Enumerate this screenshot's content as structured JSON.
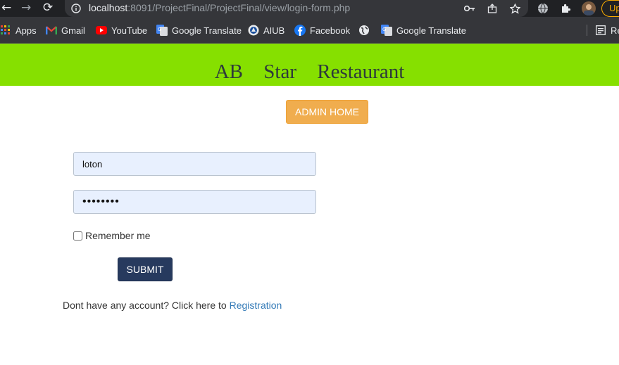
{
  "browser": {
    "url_host": "localhost",
    "url_path": ":8091/ProjectFinal/ProjectFinal/view/login-form.php",
    "update_label": "Up",
    "bookmarks": [
      {
        "label": "Apps",
        "icon": "apps-grid-icon"
      },
      {
        "label": "Gmail",
        "icon": "gmail-icon"
      },
      {
        "label": "YouTube",
        "icon": "youtube-icon"
      },
      {
        "label": "Google Translate",
        "icon": "google-translate-icon"
      },
      {
        "label": "AIUB",
        "icon": "aiub-icon"
      },
      {
        "label": "Facebook",
        "icon": "facebook-icon"
      },
      {
        "label": "",
        "icon": "globe-icon"
      },
      {
        "label": "Google Translate",
        "icon": "google-translate-icon"
      },
      {
        "label": "Re",
        "icon": "reading-list-icon"
      }
    ]
  },
  "page": {
    "title_words": [
      "AB",
      "Star",
      "Restaurant"
    ],
    "admin_home_label": "ADMIN HOME",
    "username_value": "loton",
    "password_value": "••••••••",
    "remember_label": "Remember me",
    "submit_label": "SUBMIT",
    "register_prompt": "Dont have any account? Click here to",
    "register_link": "Registration"
  },
  "colors": {
    "header_band": "#86e000",
    "admin_button": "#f0ad4e",
    "submit_button": "#273a5e",
    "link": "#337ab7",
    "input_autofill": "#e8f0fe"
  }
}
